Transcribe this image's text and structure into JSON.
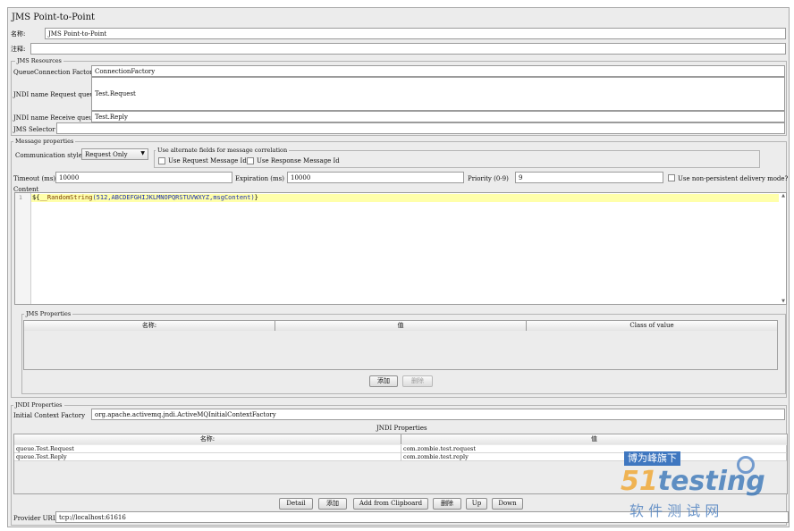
{
  "page": {
    "title": "JMS Point-to-Point",
    "name_label": "名称:",
    "name_value": "JMS Point-to-Point",
    "comment_label": "注释:",
    "comment_value": ""
  },
  "jms_resources": {
    "legend": "JMS Resources",
    "qcf_label": "QueueConnection Factory",
    "qcf_value": "ConnectionFactory",
    "req_queue_label": "JNDI name Request queue",
    "req_queue_value": "Test.Request",
    "recv_queue_label": "JNDI name Receive queue",
    "recv_queue_value": "Test.Reply",
    "selector_label": "JMS Selector",
    "selector_value": ""
  },
  "message_properties": {
    "legend": "Message properties",
    "comm_style_label": "Communication style",
    "comm_style_value": "Request Only",
    "alt_fields_legend": "Use alternate fields for message correlation",
    "use_request_id_label": "Use Request Message Id",
    "use_response_id_label": "Use Response Message Id",
    "timeout_label": "Timeout (ms)",
    "timeout_value": "10000",
    "expiration_label": "Expiration (ms)",
    "expiration_value": "10000",
    "priority_label": "Priority (0-9)",
    "priority_value": "9",
    "non_persistent_label": "Use non-persistent delivery mode?",
    "content_label": "Content",
    "editor": {
      "line_number": "1",
      "code_dollar": "${",
      "code_func": "__RandomString",
      "code_args": "(512,ABCDEFGHIJKLMNOPQRSTUVWXYZ,msgContent)",
      "code_end": "}"
    }
  },
  "jms_properties": {
    "legend": "JMS Properties",
    "columns": [
      "名称:",
      "值",
      "Class of value"
    ],
    "add_label": "添加",
    "delete_label": "删除"
  },
  "jndi_properties": {
    "legend": "JNDI Properties",
    "icf_label": "Initial Context Factory",
    "icf_value": "org.apache.activemq.jndi.ActiveMQInitialContextFactory",
    "table_title": "JNDI Properties",
    "columns": [
      "名称:",
      "值"
    ],
    "rows": [
      {
        "name": "queue.Test.Request",
        "value": "com.zombie.test.request"
      },
      {
        "name": "queue.Test.Reply",
        "value": "com.zombie.test.reply"
      }
    ],
    "buttons": {
      "detail": "Detail",
      "add": "添加",
      "add_clipboard": "Add from Clipboard",
      "delete": "删除",
      "up": "Up",
      "down": "Down"
    },
    "provider_url_label": "Provider URL",
    "provider_url_value": "tcp://localhost:61616"
  },
  "watermark": {
    "slogan": "博为峰旗下",
    "brand_num": "51",
    "brand_text": "testing",
    "sub": "软 件 测 试 网",
    "colors": {
      "num": "#f0a020",
      "text": "#2f6fb5",
      "sub": "#4a7fc0"
    }
  }
}
